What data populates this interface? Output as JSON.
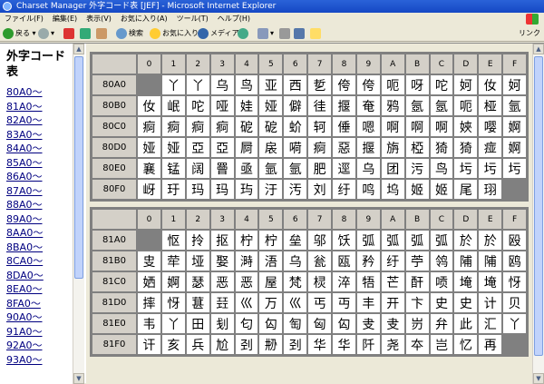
{
  "window": {
    "title": "Charset Manager 外字コード表 [JEF] - Microsoft Internet Explorer"
  },
  "menu": [
    "ファイル(F)",
    "編集(E)",
    "表示(V)",
    "お気に入り(A)",
    "ツール(T)",
    "ヘルプ(H)"
  ],
  "toolbar": {
    "back": "戻る",
    "search": "検索",
    "favorites": "お気に入り",
    "media": "メディア",
    "links": "リンク"
  },
  "sidebar": {
    "title": "外字コード表",
    "links": [
      "80A0～",
      "81A0～",
      "82A0～",
      "83A0～",
      "84A0～",
      "85A0～",
      "86A0～",
      "87A0～",
      "88A0～",
      "89A0～",
      "8AA0～",
      "8BA0～",
      "8CA0～",
      "8DA0～",
      "8EA0～",
      "8FA0～",
      "90A0～",
      "91A0～",
      "92A0～",
      "93A0～"
    ]
  },
  "tables": [
    {
      "columns": [
        "0",
        "1",
        "2",
        "3",
        "4",
        "5",
        "6",
        "7",
        "8",
        "9",
        "A",
        "B",
        "C",
        "D",
        "E",
        "F"
      ],
      "rows": [
        {
          "code": "80A0",
          "cells": [
            "",
            "丫",
            "丫",
            "乌",
            "鸟",
            "亚",
            "西",
            "乴",
            "侉",
            "侉",
            "呃",
            "呀",
            "咜",
            "妸",
            "㚢",
            "妸"
          ]
        },
        {
          "code": "80B0",
          "cells": [
            "㚢",
            "岷",
            "咜",
            "哑",
            "娃",
            "娅",
            "僻",
            "徍",
            "揠",
            "奄",
            "鸦",
            "氬",
            "氬",
            "呃",
            "桠",
            "氩"
          ]
        },
        {
          "code": "80C0",
          "cells": [
            "痾",
            "痾",
            "痾",
            "痾",
            "砨",
            "砨",
            "蚧",
            "轲",
            "倕",
            "嗯",
            "啊",
            "啊",
            "啊",
            "㛍",
            "嘤",
            "婀"
          ]
        },
        {
          "code": "80D0",
          "cells": [
            "娅",
            "娅",
            "亞",
            "亞",
            "屙",
            "扆",
            "嗬",
            "痾",
            "惡",
            "揠",
            "旃",
            "椏",
            "猗",
            "猗",
            "痖",
            "婀"
          ]
        },
        {
          "code": "80E0",
          "cells": [
            "襄",
            "锰",
            "阔",
            "罾",
            "亟",
            "氩",
            "氩",
            "肥",
            "逕",
            "乌",
            "团",
            "污",
            "鸟",
            "圬",
            "圬",
            "圬"
          ]
        },
        {
          "code": "80F0",
          "cells": [
            "岈",
            "玗",
            "玛",
            "玛",
            "玙",
            "汙",
            "汚",
            "刘",
            "纡",
            "鸣",
            "坞",
            "姬",
            "姬",
            "尾",
            "珝",
            ""
          ]
        }
      ]
    },
    {
      "columns": [
        "0",
        "1",
        "2",
        "3",
        "4",
        "5",
        "6",
        "7",
        "8",
        "9",
        "A",
        "B",
        "C",
        "D",
        "E",
        "F"
      ],
      "rows": [
        {
          "code": "81A0",
          "cells": [
            "",
            "怄",
            "拎",
            "抠",
            "柠",
            "柠",
            "垒",
            "邬",
            "饫",
            "弧",
            "弧",
            "弧",
            "弧",
            "於",
            "於",
            "殴"
          ]
        },
        {
          "code": "81B0",
          "cells": [
            "㕜",
            "荦",
            "垭",
            "娶",
            "溡",
            "浯",
            "乌",
            "瓮",
            "瓯",
            "矜",
            "纡",
            "苧",
            "鸰",
            "陠",
            "陠",
            "鸥"
          ]
        },
        {
          "code": "81C0",
          "cells": [
            "㛉",
            "婀",
            "瑟",
            "恶",
            "恶",
            "屋",
            "梵",
            "棂",
            "淬",
            "牾",
            "芒",
            "酐",
            "唝",
            "埯",
            "埯",
            "㤉"
          ]
        },
        {
          "code": "81D0",
          "cells": [
            "摔",
            "㤉",
            "葚",
            "㠭",
            "巛",
            "万",
            "巛",
            "丐",
            "丏",
            "丰",
            "开",
            "卞",
            "史",
            "史",
            "计",
            "贝"
          ]
        },
        {
          "code": "81E0",
          "cells": [
            "韦",
            "丫",
            "田",
            "刬",
            "匂",
            "匃",
            "匋",
            "匈",
            "匃",
            "叏",
            "叏",
            "岃",
            "弁",
            "此",
            "汇",
            "丫"
          ]
        },
        {
          "code": "81F0",
          "cells": [
            "讦",
            "亥",
            "兵",
            "尬",
            "刭",
            "刱",
            "刭",
            "华",
            "华",
            "阡",
            "尧",
            "夲",
            "岂",
            "忆",
            "再",
            ""
          ]
        }
      ]
    }
  ]
}
